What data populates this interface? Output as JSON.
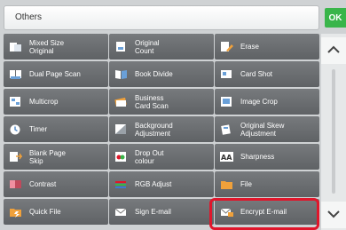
{
  "header": {
    "title": "Others",
    "ok_label": "OK"
  },
  "tiles": [
    {
      "label": "Mixed Size\nOriginal",
      "icon": "mixed-size-original-icon"
    },
    {
      "label": "Original\nCount",
      "icon": "original-count-icon"
    },
    {
      "label": "Erase",
      "icon": "erase-icon"
    },
    {
      "label": "Dual Page Scan",
      "icon": "dual-page-scan-icon"
    },
    {
      "label": "Book Divide",
      "icon": "book-divide-icon"
    },
    {
      "label": "Card Shot",
      "icon": "card-shot-icon"
    },
    {
      "label": "Multicrop",
      "icon": "multicrop-icon"
    },
    {
      "label": "Business\nCard Scan",
      "icon": "business-card-scan-icon"
    },
    {
      "label": "Image Crop",
      "icon": "image-crop-icon"
    },
    {
      "label": "Timer",
      "icon": "timer-icon"
    },
    {
      "label": "Background\nAdjustment",
      "icon": "background-adjustment-icon"
    },
    {
      "label": "Original Skew\nAdjustment",
      "icon": "original-skew-adjustment-icon"
    },
    {
      "label": "Blank Page\nSkip",
      "icon": "blank-page-skip-icon"
    },
    {
      "label": "Drop Out\ncolour",
      "icon": "drop-out-colour-icon"
    },
    {
      "label": "Sharpness",
      "icon": "sharpness-icon"
    },
    {
      "label": "Contrast",
      "icon": "contrast-icon"
    },
    {
      "label": "RGB Adjust",
      "icon": "rgb-adjust-icon"
    },
    {
      "label": "File",
      "icon": "file-icon"
    },
    {
      "label": "Quick File",
      "icon": "quick-file-icon"
    },
    {
      "label": "Sign E-mail",
      "icon": "sign-email-icon"
    },
    {
      "label": "Encrypt E-mail",
      "icon": "encrypt-email-icon"
    }
  ],
  "scroll": {
    "up": "chevron-up-icon",
    "down": "chevron-down-icon"
  },
  "colors": {
    "ok": "#39b54a",
    "highlight": "#e0162b",
    "tile": "#6b6e71"
  }
}
